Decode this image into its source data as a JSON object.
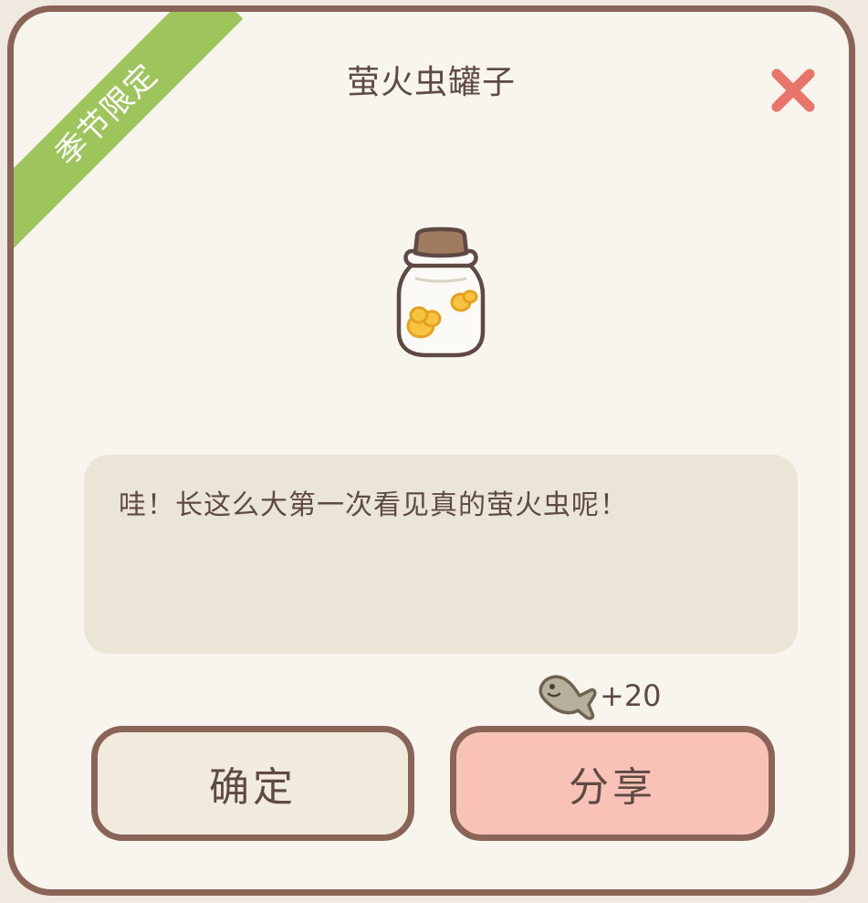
{
  "dialog": {
    "badge": "季节限定",
    "title": "萤火虫罐子",
    "close_icon": "close-icon",
    "item_icon": "firefly-jar-icon",
    "description": "哇！长这么大第一次看见真的萤火虫呢！",
    "reward": {
      "icon": "fish-icon",
      "value": "+20"
    },
    "buttons": {
      "confirm": "确定",
      "share": "分享"
    }
  },
  "colors": {
    "border": "#8a6456",
    "background": "#f8f5ef",
    "badge": "#9dc55c",
    "close": "#e8746a",
    "description_bg": "#ebe5d8",
    "confirm_bg": "#f0ebdd",
    "share_bg": "#f8c3b6",
    "text": "#5e4a42"
  }
}
